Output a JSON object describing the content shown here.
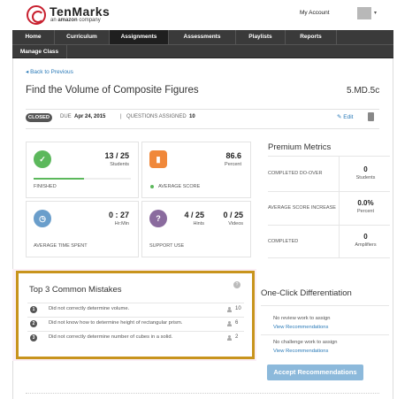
{
  "brand": {
    "name": "TenMarks",
    "sub_prefix": "an ",
    "sub_bold": "amazon",
    "sub_suffix": " company"
  },
  "account": {
    "label": "My Account"
  },
  "nav": {
    "items": [
      "Home",
      "Curriculum",
      "Assignments",
      "Assessments",
      "Playlists",
      "Reports"
    ],
    "active": "Assignments",
    "row2": [
      "Manage Class"
    ]
  },
  "back_link": "Back to Previous",
  "assignment": {
    "title": "Find the Volume of Composite Figures",
    "standard": "5.MD.5c",
    "status": "CLOSED",
    "due_label": "DUE",
    "due_date": "Apr 24, 2015",
    "questions_label": "QUESTIONS ASSIGNED",
    "questions_count": "10",
    "edit_label": "Edit"
  },
  "stats": {
    "finished": {
      "value": "13 / 25",
      "unit": "Students",
      "label": "FINISHED",
      "progress": 0.52
    },
    "average_score": {
      "value": "86.6",
      "unit": "Percent",
      "label": "AVERAGE SCORE"
    },
    "average_time": {
      "value": "0 : 27",
      "unit": "Hr:Min",
      "label": "AVERAGE TIME SPENT"
    },
    "support_use": {
      "hints_value": "4 / 25",
      "hints_unit": "Hints",
      "videos_value": "0 / 25",
      "videos_unit": "Videos",
      "label": "SUPPORT USE"
    }
  },
  "premium": {
    "title": "Premium Metrics",
    "rows": [
      {
        "label": "COMPLETED DO-OVER",
        "value": "0",
        "unit": "Students"
      },
      {
        "label": "AVERAGE SCORE INCREASE",
        "value": "0.0%",
        "unit": "Percent"
      },
      {
        "label": "COMPLETED",
        "value": "0",
        "unit": "Amplifiers"
      }
    ]
  },
  "mistakes": {
    "title": "Top 3 Common Mistakes",
    "help": "?",
    "items": [
      {
        "num": "1",
        "text": "Did not correctly determine volume.",
        "count": "10"
      },
      {
        "num": "2",
        "text": "Did not know how to determine height of rectangular prism.",
        "count": "6"
      },
      {
        "num": "3",
        "text": "Did not correctly determine number of cubes in a solid.",
        "count": "2"
      }
    ]
  },
  "differentiation": {
    "title": "One-Click Differentiation",
    "review_text": "No review work to assign",
    "review_link": "View Recommendations",
    "challenge_text": "No challenge work to assign",
    "challenge_link": "View Recommendations",
    "accept_button": "Accept Recommendations"
  },
  "colors": {
    "nav_bg": "#3a3a3a",
    "link": "#2a7ab8",
    "highlight_border": "#c8941d",
    "pink_band": "#fbeff6",
    "icon_green": "#5cb85c",
    "icon_orange": "#f0883a",
    "icon_blue": "#6a9ecb",
    "icon_purple": "#8a6b9e",
    "accept_button": "#8cb9db"
  }
}
